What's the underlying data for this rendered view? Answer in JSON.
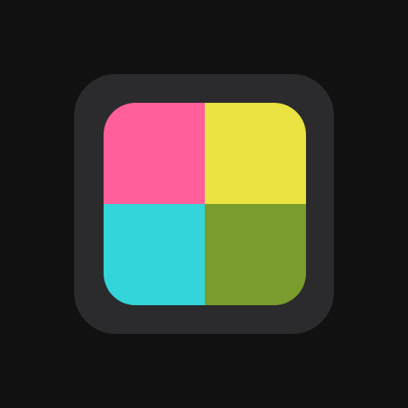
{
  "icon": {
    "name": "four-color-grid-icon",
    "background": "#111111",
    "frame_color": "#2b2b2d",
    "tiles": [
      {
        "name": "pink-tile",
        "color": "#ff5f9a"
      },
      {
        "name": "yellow-tile",
        "color": "#eae342"
      },
      {
        "name": "cyan-tile",
        "color": "#33d4da"
      },
      {
        "name": "olive-tile",
        "color": "#799c2c"
      }
    ]
  }
}
